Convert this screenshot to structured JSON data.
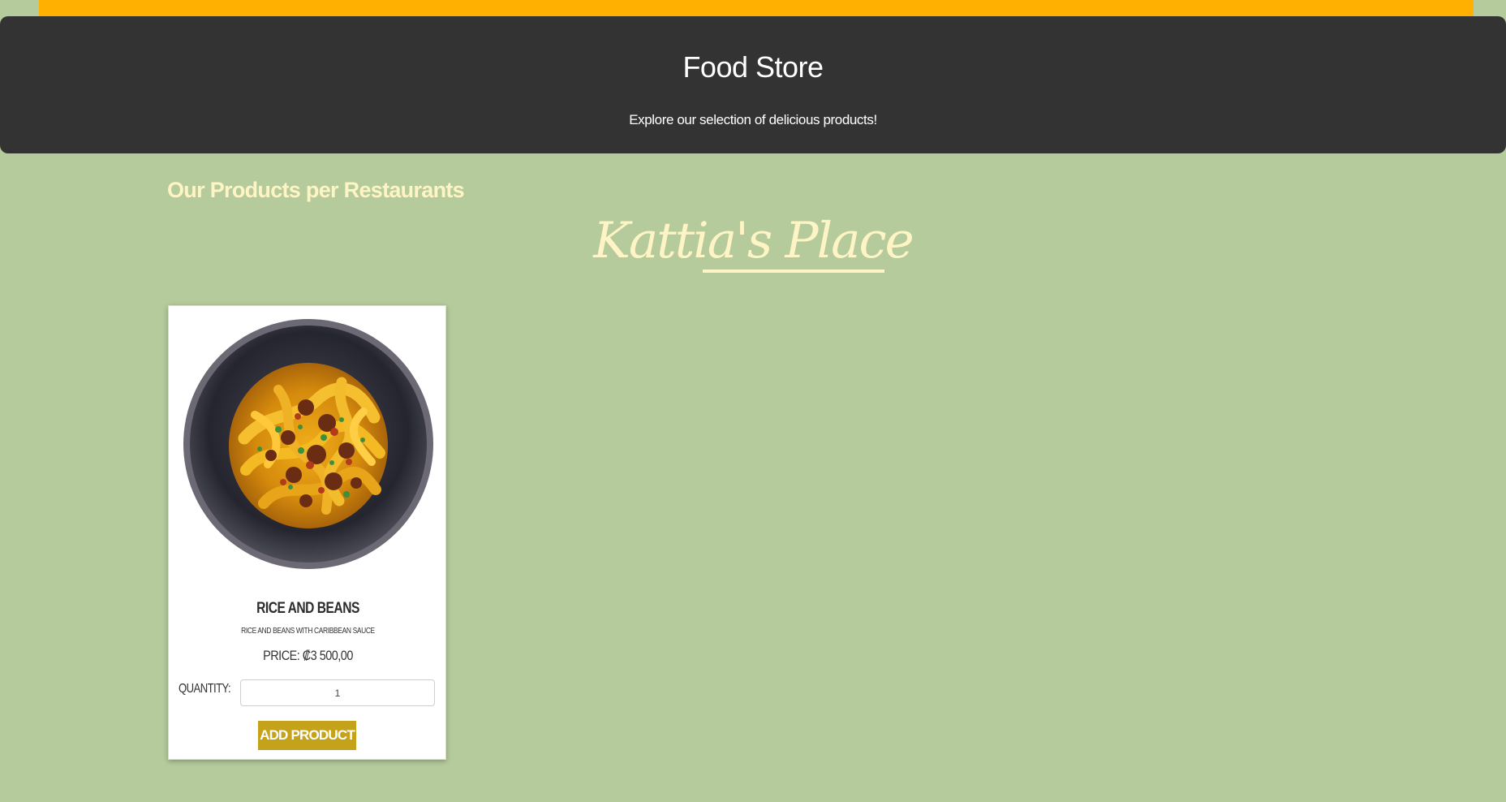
{
  "header": {
    "title": "Food Store",
    "subtitle": "Explore our selection of delicious products!"
  },
  "section": {
    "title": "Our Products per Restaurants"
  },
  "restaurants": [
    {
      "name": "Kattia's Place",
      "products": [
        {
          "name": "RICE AND BEANS",
          "description": "RICE AND BEANS WITH CARIBBEAN SAUCE",
          "price_text": "PRICE: ₡3 500,00",
          "quantity_label": "QUANTITY:",
          "quantity_value": "1",
          "button_label": "ADD PRODUCT",
          "image_icon": "pasta-bowl-icon"
        }
      ]
    }
  ],
  "colors": {
    "accent_top": "#ffb000",
    "header_background": "#333333",
    "page_background": "#b5cb9b",
    "heading_text": "#fff4c5",
    "button_background": "#c4a21a"
  }
}
